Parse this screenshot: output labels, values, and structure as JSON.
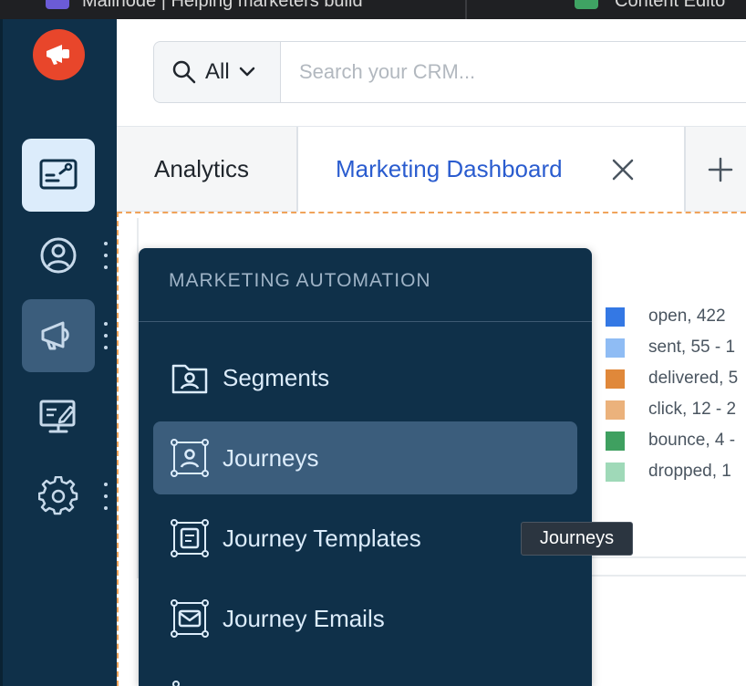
{
  "browser": {
    "tabs": [
      {
        "label": "Mailnode | Helping marketers build"
      },
      {
        "label": "Content Edito"
      }
    ]
  },
  "search": {
    "scope": "All",
    "placeholder": "Search your CRM..."
  },
  "tabs": [
    {
      "label": "Analytics"
    },
    {
      "label": "Marketing Dashboard"
    }
  ],
  "legend": [
    {
      "text": "open,  422",
      "color": "#3478e4"
    },
    {
      "text": "sent,  55 - 1",
      "color": "#8fbcf4"
    },
    {
      "text": "delivered,  5",
      "color": "#e0883a"
    },
    {
      "text": "click,  12 - 2",
      "color": "#ebb27c"
    },
    {
      "text": "bounce,  4 -",
      "color": "#3fa060"
    },
    {
      "text": "dropped,  1",
      "color": "#9fd9b8"
    }
  ],
  "menu": {
    "title": "MARKETING AUTOMATION",
    "items": [
      {
        "label": "Segments",
        "icon": "folder-user-icon"
      },
      {
        "label": "Journeys",
        "icon": "journey-icon"
      },
      {
        "label": "Journey Templates",
        "icon": "journey-template-icon"
      },
      {
        "label": "Journey Emails",
        "icon": "journey-email-icon"
      }
    ]
  },
  "tooltip": {
    "text": "Journeys"
  },
  "colors": {
    "rail": "#0f3049",
    "accent": "#2a5ccf",
    "brand": "#e8462b"
  }
}
